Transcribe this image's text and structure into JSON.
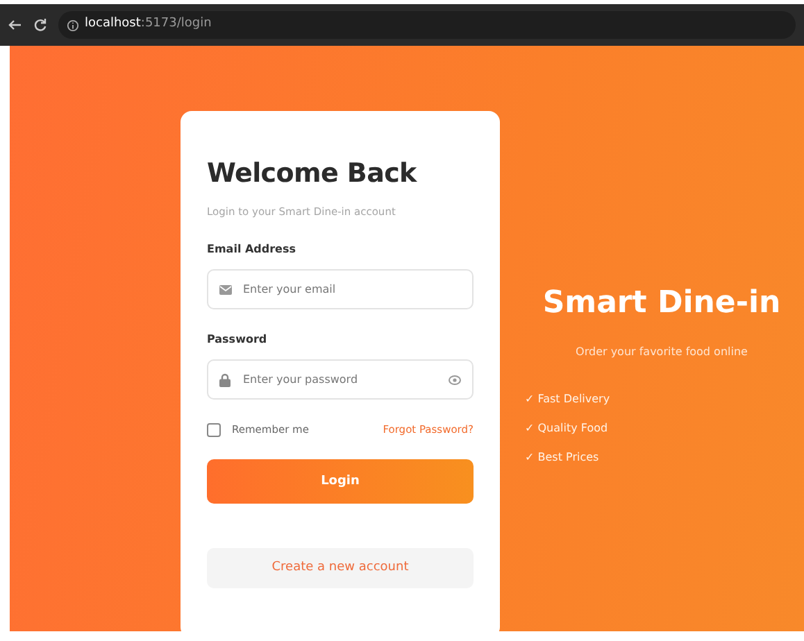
{
  "browser": {
    "url_host": "localhost",
    "url_path": ":5173/login"
  },
  "login_card": {
    "title": "Welcome Back",
    "subtitle": "Login to your Smart Dine-in account",
    "email": {
      "label": "Email Address",
      "placeholder": "Enter your email"
    },
    "password": {
      "label": "Password",
      "placeholder": "Enter your password"
    },
    "remember_me": {
      "label": "Remember me",
      "checked": false
    },
    "forgot_link": "Forgot Password?",
    "login_button": "Login",
    "create_account_button": "Create a new account"
  },
  "promo": {
    "title": "Smart Dine-in",
    "tagline": "Order your favorite food online",
    "features": [
      "✓ Fast Delivery",
      "✓ Quality Food",
      "✓ Best Prices"
    ]
  }
}
